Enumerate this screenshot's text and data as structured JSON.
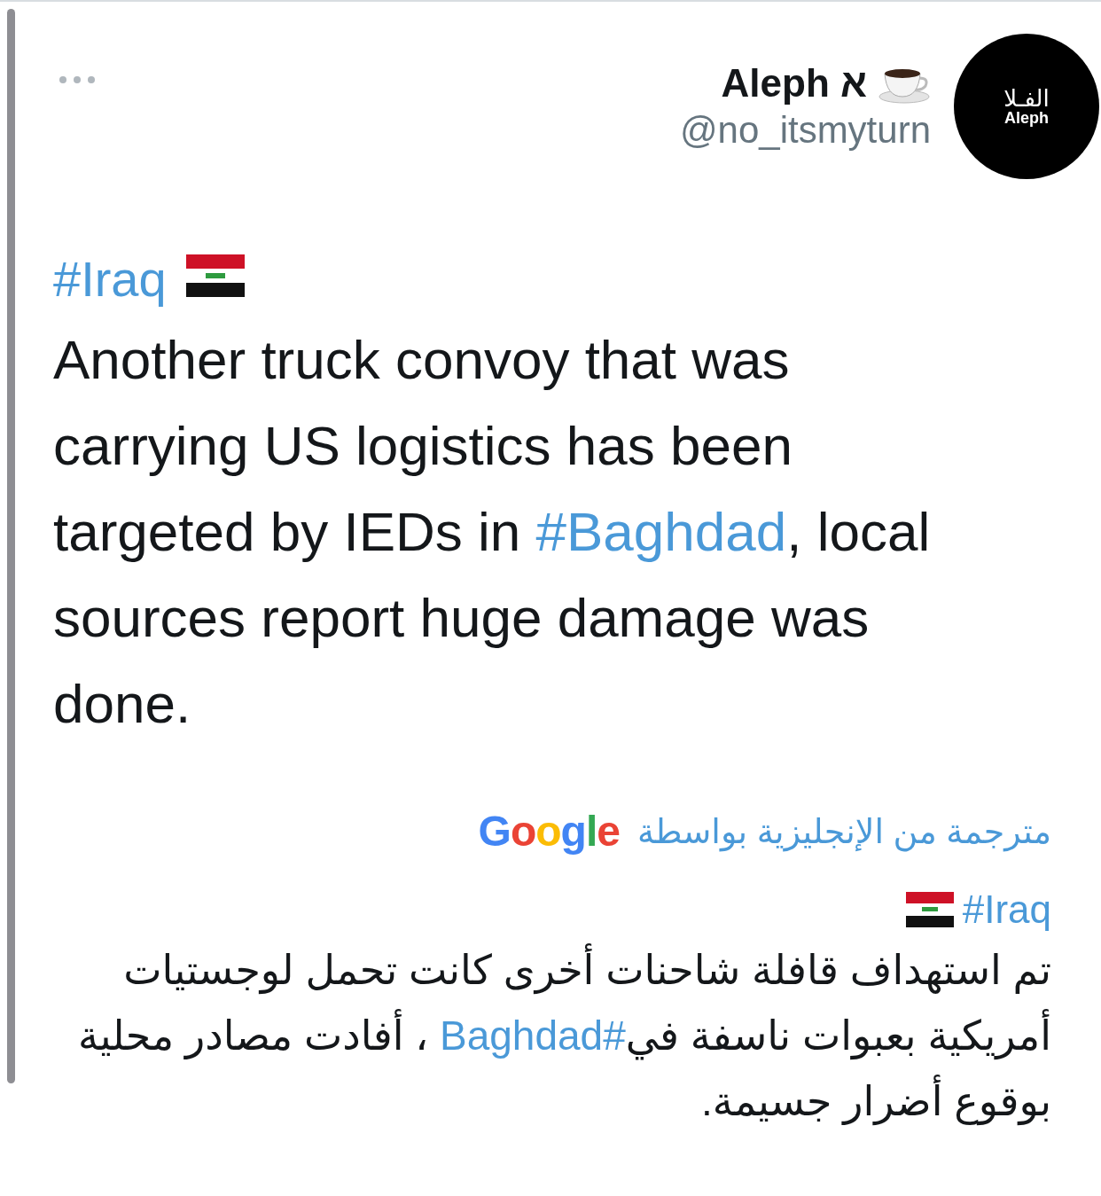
{
  "author": {
    "name": "Aleph א",
    "handle": "@no_itsmyturn",
    "avatar_text": [
      "الفـلا",
      "Aleph"
    ]
  },
  "tweet": {
    "hashtag": "#Iraq",
    "body": [
      {
        "kind": "text",
        "text": "Another truck convoy that was carrying US logistics has been targeted by IEDs in "
      },
      {
        "kind": "hashtag",
        "text": "#Baghdad"
      },
      {
        "kind": "text",
        "text": ", local sources report huge damage was done."
      }
    ]
  },
  "translation": {
    "label": "مترجمة من الإنجليزية بواسطة",
    "provider": "Google",
    "hashtag": "#Iraq",
    "body": [
      {
        "kind": "text",
        "text": "تم استهداف قافلة شاحنات أخرى كانت تحمل لوجستيات أمريكية بعبوات ناسفة في"
      },
      {
        "kind": "hashtag",
        "text": "#Baghdad"
      },
      {
        "kind": "text",
        "text": " ، أفادت مصادر محلية بوقوع أضرار جسيمة."
      }
    ]
  }
}
